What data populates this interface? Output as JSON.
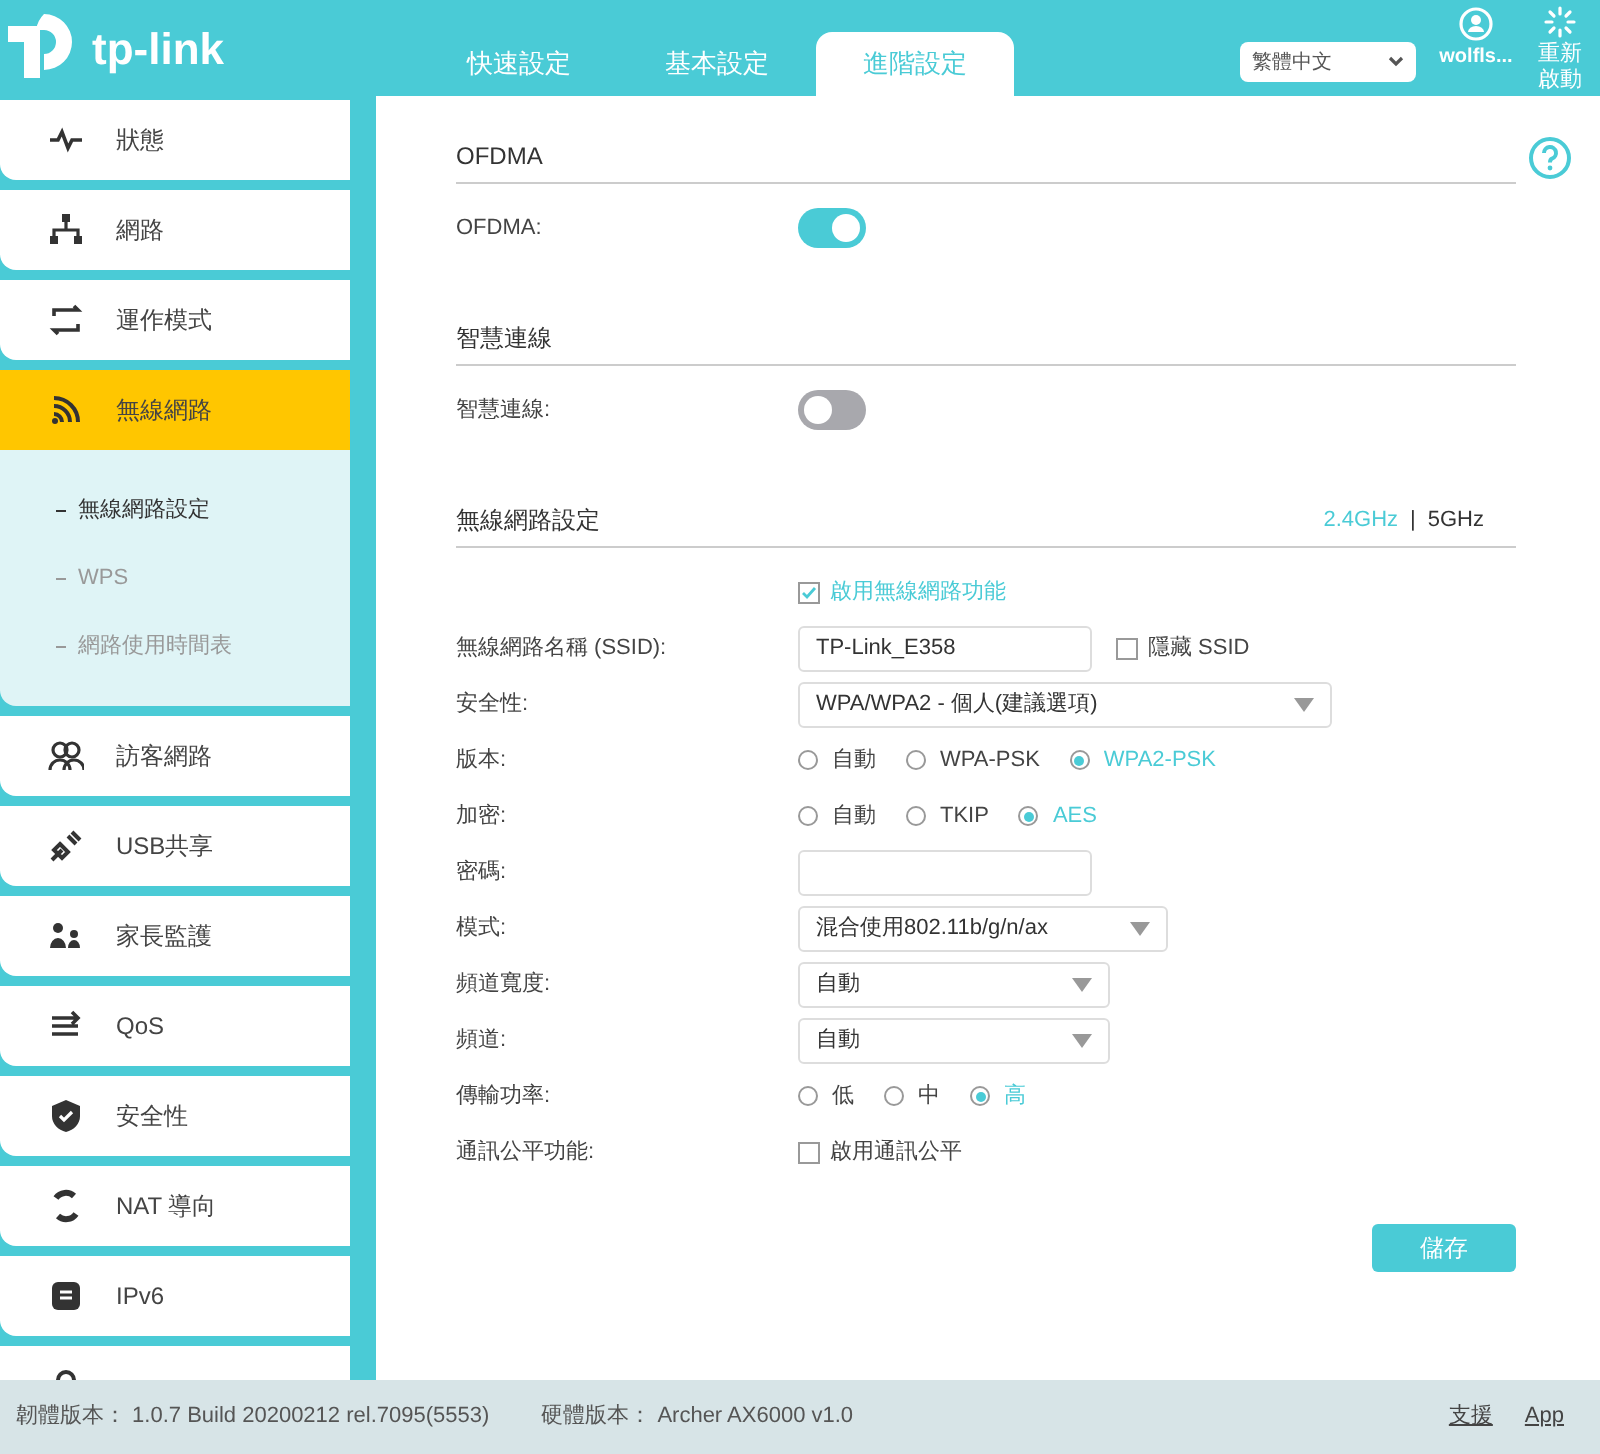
{
  "header": {
    "logo": "tp-link",
    "tabs": [
      {
        "label": "快速設定",
        "selected": false
      },
      {
        "label": "基本設定",
        "selected": false
      },
      {
        "label": "進階設定",
        "selected": true
      }
    ],
    "language": "繁體中文",
    "user": "wolfls...",
    "reboot": "重新啟動"
  },
  "sidebar": {
    "items": [
      {
        "label": "狀態",
        "selected": false
      },
      {
        "label": "網路",
        "selected": false
      },
      {
        "label": "運作模式",
        "selected": false
      },
      {
        "label": "無線網路",
        "selected": true,
        "children": [
          {
            "label": "無線網路設定",
            "selected": true
          },
          {
            "label": "WPS",
            "selected": false
          },
          {
            "label": "網路使用時間表",
            "selected": false
          }
        ]
      },
      {
        "label": "訪客網路",
        "selected": false
      },
      {
        "label": "USB共享",
        "selected": false
      },
      {
        "label": "家長監護",
        "selected": false
      },
      {
        "label": "QoS",
        "selected": false
      },
      {
        "label": "安全性",
        "selected": false
      },
      {
        "label": "NAT 導向",
        "selected": false
      },
      {
        "label": "IPv6",
        "selected": false
      },
      {
        "selected": false
      }
    ]
  },
  "sections": [
    {
      "title": "OFDMA",
      "rows": [
        {
          "kind": "toggle",
          "label": "OFDMA:",
          "on": true
        }
      ]
    },
    {
      "title": "智慧連線",
      "rows": [
        {
          "kind": "toggle",
          "label": "智慧連線:",
          "on": false
        }
      ]
    },
    {
      "title": "無線網路設定",
      "bands": [
        {
          "label": "2.4GHz",
          "selected": true
        },
        {
          "label": "5GHz",
          "selected": false
        }
      ],
      "separator": "|",
      "rows": [
        {
          "kind": "checkbox",
          "text": "啟用無線網路功能",
          "checked": true
        },
        {
          "kind": "text",
          "label": "無線網路名稱 (SSID):",
          "value": "TP-Link_E358",
          "option": {
            "text": "隱藏 SSID",
            "checked": false
          }
        },
        {
          "kind": "select",
          "label": "安全性:",
          "value": "WPA/WPA2 - 個人(建議選項)"
        },
        {
          "kind": "radio",
          "label": "版本:",
          "options": [
            {
              "label": "自動",
              "selected": false
            },
            {
              "label": "WPA-PSK",
              "selected": false
            },
            {
              "label": "WPA2-PSK",
              "selected": true
            }
          ]
        },
        {
          "kind": "radio",
          "label": "加密:",
          "options": [
            {
              "label": "自動",
              "selected": false
            },
            {
              "label": "TKIP",
              "selected": false
            },
            {
              "label": "AES",
              "selected": true
            }
          ]
        },
        {
          "kind": "text",
          "label": "密碼:"
        },
        {
          "kind": "select",
          "label": "模式:",
          "value": "混合使用802.11b/g/n/ax"
        },
        {
          "kind": "select",
          "label": "頻道寬度:",
          "value": "自動"
        },
        {
          "kind": "select",
          "label": "頻道:",
          "value": "自動"
        },
        {
          "kind": "radio",
          "label": "傳輸功率:",
          "options": [
            {
              "label": "低",
              "selected": false
            },
            {
              "label": "中",
              "selected": false
            },
            {
              "label": "高",
              "selected": true
            }
          ]
        },
        {
          "kind": "checkbox",
          "label": "通訊公平功能:",
          "text": "啟用通訊公平",
          "checked": false
        }
      ]
    }
  ],
  "save": "儲存",
  "footer": {
    "firmware": "韌體版本： 1.0.7 Build 20200212 rel.7095(5553)",
    "hardware": "硬體版本： Archer AX6000 v1.0",
    "links": [
      "支援",
      "App"
    ]
  }
}
